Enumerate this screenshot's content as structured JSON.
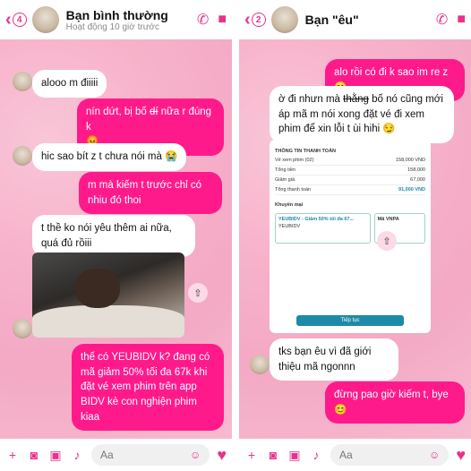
{
  "left": {
    "back_count": "4",
    "contact_name": "Bạn bình thường",
    "status": "Hoạt động 10 giờ trước",
    "messages": [
      "alooo m điiiii",
      "nín dứt, bị bố ",
      "dí",
      " nữa r đúng k",
      "😡",
      "hic sao bít z t chưa nói mà 😭",
      "m mà kiếm t trước chỉ có nhiu đó thoi",
      "t thề ko nói yêu thêm ai nữa, quá đủ rồiii",
      "thế có YEUBIDV k? đang có mã giảm 50% tối đa 67k khi đặt vé xem phim trên app BIDV kè con nghiện phim kiaa"
    ],
    "composer_placeholder": "Aa"
  },
  "right": {
    "back_count": "2",
    "contact_name": "Bạn \"êu\"",
    "messages": [
      "alo rồi có đi k sao im re z 😊",
      "ờ đi nhưn mà ",
      "thằng",
      " bố nó cũng mới áp mã m nói xong đặt vé đi xem phim để xin lỗi t ùi hihi 😏",
      "tks bạn êu vì đã giới thiệu mã ngonnn",
      "đừng pao giờ kiếm t, bye 😊"
    ],
    "screenshot": {
      "header": "THÔNG TIN THANH TOÁN",
      "item": "Vé xem phim (02)",
      "item_price": "158,000 VND",
      "rows": [
        [
          "Tổng tiền",
          "158,000"
        ],
        [
          "Giảm giá",
          "67,000"
        ],
        [
          "Tổng thanh toán",
          "91,000 VND"
        ]
      ],
      "promo_title": "Khuyến mại",
      "coupon_code": "YEUBIDV",
      "coupon_text": "YEUBIDV - Giảm 50% tối đa 67...",
      "coupon_text_2": "Mã VNPA",
      "button": "Tiếp tục"
    },
    "composer_placeholder": "Aa"
  }
}
